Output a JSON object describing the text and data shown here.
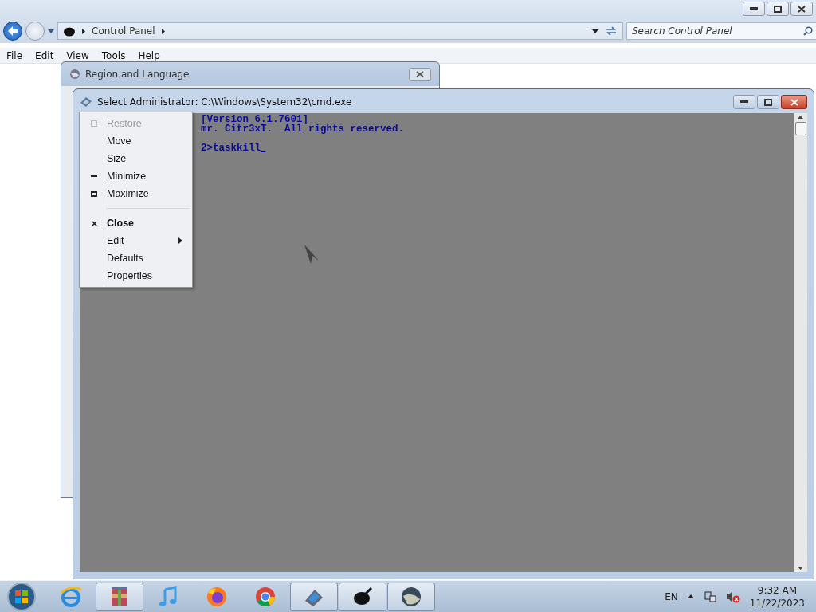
{
  "explorer": {
    "breadcrumb": "Control Panel",
    "search": {
      "placeholder": "Search Control Panel"
    },
    "menu": [
      "File",
      "Edit",
      "View",
      "Tools",
      "Help"
    ]
  },
  "region_dialog": {
    "title": "Region and Language"
  },
  "console": {
    "title": "Select Administrator: C:\\Windows\\System32\\cmd.exe",
    "paragraphs": [
      [
        "[Version 6.1.7601]",
        "mr. Citr3xT.  All rights reserved."
      ],
      [
        "2>taskkill"
      ]
    ]
  },
  "system_menu": [
    {
      "label": "Restore",
      "disabled": true,
      "default": false,
      "submenu": false
    },
    {
      "label": "Move",
      "disabled": false,
      "default": false,
      "submenu": false
    },
    {
      "label": "Size",
      "disabled": false,
      "default": false,
      "submenu": false
    },
    {
      "label": "Minimize",
      "disabled": false,
      "default": false,
      "submenu": false
    },
    {
      "label": "Maximize",
      "disabled": false,
      "default": false,
      "submenu": false
    },
    {
      "label": "Close",
      "disabled": false,
      "default": true,
      "submenu": false
    },
    {
      "label": "Edit",
      "disabled": false,
      "default": false,
      "submenu": true
    },
    {
      "label": "Defaults",
      "disabled": false,
      "default": false,
      "submenu": false
    },
    {
      "label": "Properties",
      "disabled": false,
      "default": false,
      "submenu": false
    }
  ],
  "taskbar": {
    "apps": [
      {
        "running": false
      },
      {
        "running": true
      },
      {
        "running": false
      },
      {
        "running": false
      },
      {
        "running": false
      },
      {
        "running": true
      },
      {
        "running": true
      },
      {
        "running": true
      }
    ],
    "language": "EN",
    "time": "9:32 AM",
    "date": "11/22/2023"
  }
}
